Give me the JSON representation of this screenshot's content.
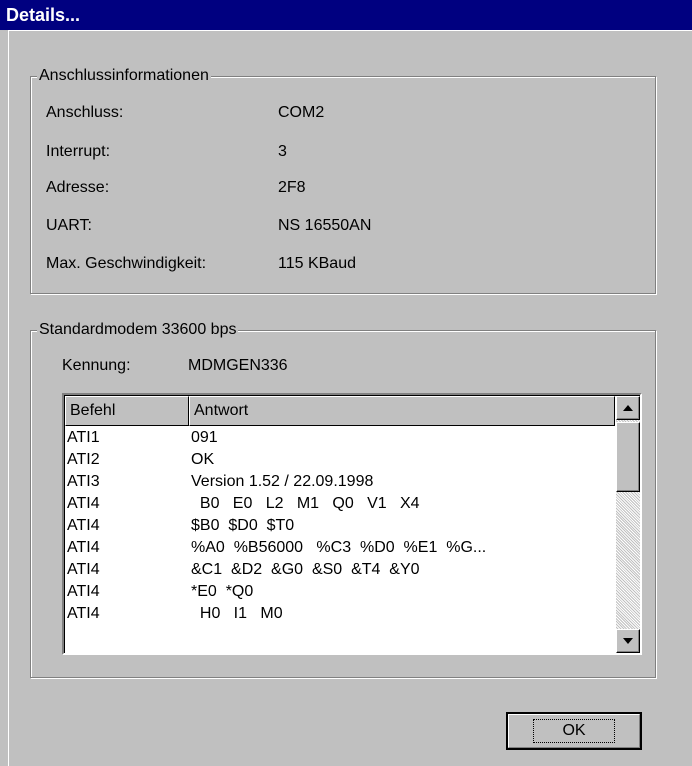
{
  "window": {
    "title": "Details..."
  },
  "connection": {
    "group_title": "Anschlussinformationen",
    "rows": [
      {
        "label": "Anschluss:",
        "value": "COM2"
      },
      {
        "label": "Interrupt:",
        "value": "3"
      },
      {
        "label": "Adresse:",
        "value": "2F8"
      },
      {
        "label": "UART:",
        "value": "NS 16550AN"
      },
      {
        "label": "Max. Geschwindigkeit:",
        "value": "115 KBaud"
      }
    ]
  },
  "modem": {
    "group_title": "Standardmodem 33600 bps",
    "id_label": "Kennung:",
    "id_value": "MDMGEN336",
    "columns": [
      "Befehl",
      "Antwort"
    ],
    "rows": [
      {
        "cmd": "ATI1",
        "resp": "091"
      },
      {
        "cmd": "ATI2",
        "resp": "OK"
      },
      {
        "cmd": "ATI3",
        "resp": "Version 1.52 / 22.09.1998"
      },
      {
        "cmd": "ATI4",
        "resp": "  B0   E0   L2   M1   Q0   V1   X4"
      },
      {
        "cmd": "ATI4",
        "resp": "$B0  $D0  $T0"
      },
      {
        "cmd": "ATI4",
        "resp": "%A0  %B56000   %C3  %D0  %E1  %G..."
      },
      {
        "cmd": "ATI4",
        "resp": "&C1  &D2  &G0  &S0  &T4  &Y0"
      },
      {
        "cmd": "ATI4",
        "resp": "*E0  *Q0"
      },
      {
        "cmd": "ATI4",
        "resp": "  H0   I1   M0"
      }
    ]
  },
  "buttons": {
    "ok": "OK"
  }
}
